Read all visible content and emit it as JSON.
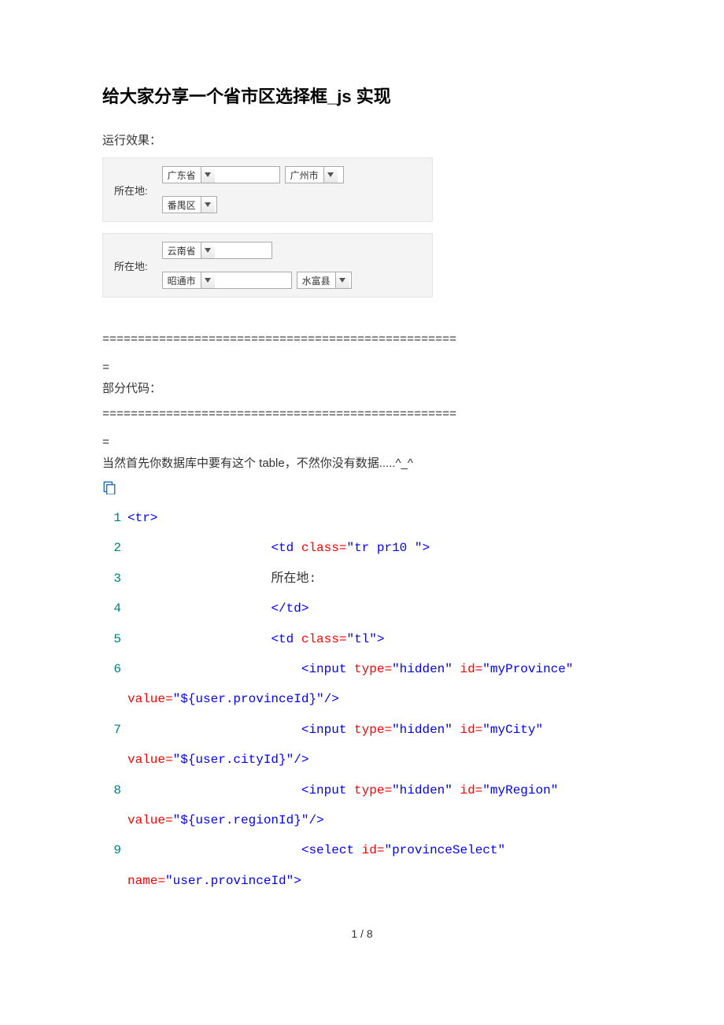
{
  "title": "给大家分享一个省市区选择框_js 实现",
  "run_effect": "运行效果：",
  "demo1": {
    "label": "所在地:",
    "province": "广东省",
    "city": "广州市",
    "district": "番禺区"
  },
  "demo2": {
    "label": "所在地:",
    "province": "云南省",
    "city": "昭通市",
    "district": "水富县"
  },
  "separator1": "==================================================",
  "separator1b": "=",
  "partial_code": "部分代码：",
  "separator2": "==================================================",
  "separator2b": "=",
  "note": "当然首先你数据库中要有这个 table，不然你没有数据.....^_^",
  "code": {
    "l1": "<tr>",
    "l2_tag_open": "<td",
    "l2_class": " class=",
    "l2_val": "\"tr pr10 \"",
    "l2_close": ">",
    "l3": "所在地:",
    "l4": "</td>",
    "l5_tag_open": "<td",
    "l5_class": " class=",
    "l5_val": "\"tl\"",
    "l5_close": ">",
    "l6_tag": "<input",
    "l6_type": " type=",
    "l6_type_v": "\"hidden\"",
    "l6_id": " id=",
    "l6_id_v": "\"myProvince\"",
    "l6b_value": "value=",
    "l6b_value_v": "\"${user.provinceId}\"",
    "l6b_close": "/>",
    "l7_tag": "<input",
    "l7_type": " type=",
    "l7_type_v": "\"hidden\"",
    "l7_id": " id=",
    "l7_id_v": "\"myCity\"",
    "l7b_value": "value=",
    "l7b_value_v": "\"${user.cityId}\"",
    "l7b_close": "/>",
    "l8_tag": "<input",
    "l8_type": " type=",
    "l8_type_v": "\"hidden\"",
    "l8_id": " id=",
    "l8_id_v": "\"myRegion\"",
    "l8b_value": "value=",
    "l8b_value_v": "\"${user.regionId}\"",
    "l8b_close": "/>",
    "l9_tag": "<select",
    "l9_id": " id=",
    "l9_id_v": "\"provinceSelect\"",
    "l9b_name": "name=",
    "l9b_name_v": "\"user.provinceId\"",
    "l9b_close": ">"
  },
  "line_numbers": [
    "1",
    "2",
    "3",
    "4",
    "5",
    "6",
    "7",
    "8",
    "9"
  ],
  "page_num": "1 / 8"
}
